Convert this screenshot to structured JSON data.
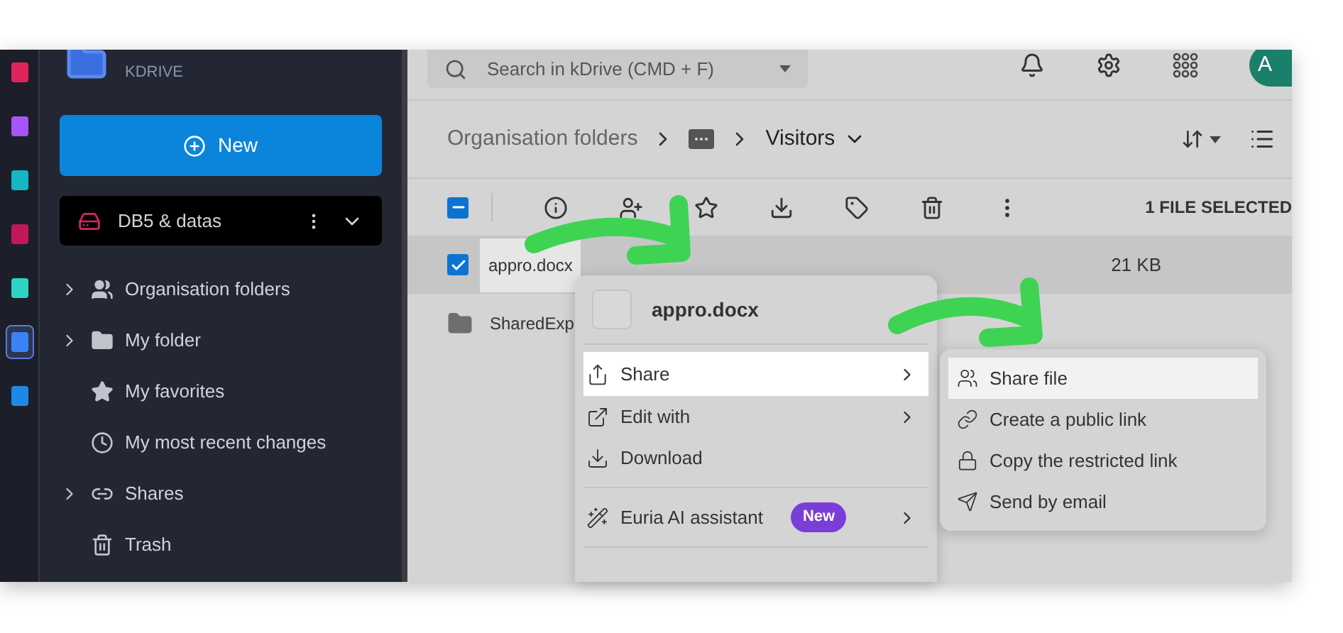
{
  "rail": {
    "apps": [
      {
        "color": "#e0245e",
        "selected": false
      },
      {
        "color": "#a855f7",
        "selected": false
      },
      {
        "color": "#14b8c4",
        "selected": false
      },
      {
        "color": "#c2185b",
        "selected": false
      },
      {
        "color": "#2dd4bf",
        "selected": false
      },
      {
        "color": "#3b82f6",
        "selected": true
      },
      {
        "color": "#1e88e5",
        "selected": false
      }
    ]
  },
  "sidebar": {
    "brand_caption": "KDRIVE",
    "new_button": "New",
    "drive": {
      "name": "DB5 & datas"
    },
    "items": [
      {
        "label": "Organisation folders",
        "expandable": true
      },
      {
        "label": "My folder",
        "expandable": true
      },
      {
        "label": "My favorites",
        "expandable": false
      },
      {
        "label": "My most recent changes",
        "expandable": false
      },
      {
        "label": "Shares",
        "expandable": true
      },
      {
        "label": "Trash",
        "expandable": false
      }
    ]
  },
  "topbar": {
    "search": {
      "placeholder": "Search in kDrive (CMD + F)"
    },
    "avatar": "A"
  },
  "breadcrumb": [
    {
      "kind": "text",
      "label": "Organisation folders"
    },
    {
      "kind": "folder"
    },
    {
      "kind": "current",
      "label": "Visitors"
    }
  ],
  "toolbar": {
    "select_all": {
      "indeterminate": true
    },
    "selection_count": "1 FILE SELECTED"
  },
  "files": [
    {
      "kind": "file",
      "name": "appro.docx",
      "size": "21 KB",
      "checked": true,
      "selected": true
    },
    {
      "kind": "folder",
      "name": "SharedExp",
      "selected": false
    }
  ],
  "context_menu": {
    "title": "appro.docx",
    "items": [
      {
        "kind": "item",
        "label": "Share",
        "submenu": true,
        "selected": true
      },
      {
        "kind": "item",
        "label": "Edit with",
        "submenu": true,
        "selected": false
      },
      {
        "kind": "item",
        "label": "Download",
        "submenu": false,
        "selected": false
      },
      {
        "kind": "divider"
      },
      {
        "kind": "item",
        "label": "Euria AI assistant",
        "badge": "New",
        "submenu": true,
        "selected": false
      },
      {
        "kind": "divider"
      }
    ]
  },
  "submenu": {
    "items": [
      {
        "label": "Share file",
        "selected": true
      },
      {
        "label": "Create a public link",
        "selected": false
      },
      {
        "label": "Copy the restricted link",
        "selected": false
      },
      {
        "label": "Send by email",
        "selected": false
      }
    ]
  }
}
